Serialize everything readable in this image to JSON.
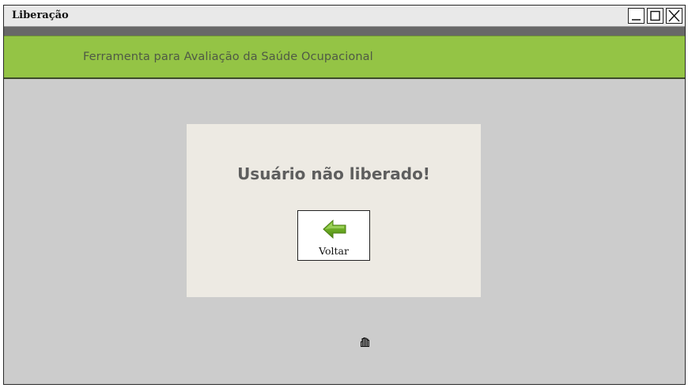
{
  "window": {
    "title": "Liberação",
    "controls": [
      {
        "name": "minimize",
        "icon": "minimize-icon"
      },
      {
        "name": "maximize",
        "icon": "maximize-icon"
      },
      {
        "name": "close",
        "icon": "close-icon"
      }
    ]
  },
  "header": {
    "title": "Ferramenta para Avaliação da Saúde Ocupacional"
  },
  "panel": {
    "message": "Usuário não liberado!",
    "back_button": {
      "label": "Voltar",
      "icon": "back-arrow-icon"
    }
  },
  "cursor": {
    "icon": "hand-cursor-icon"
  },
  "colors": {
    "header_green": "#94c445",
    "window_bg": "#cccccc",
    "panel_bg": "#edeae3",
    "arrow_green": "#6aa51c"
  }
}
